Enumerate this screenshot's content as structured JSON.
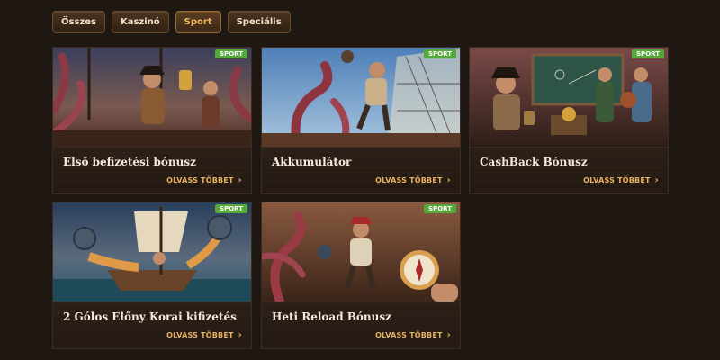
{
  "tabs": [
    {
      "label": "Összes"
    },
    {
      "label": "Kaszinó"
    },
    {
      "label": "Sport"
    },
    {
      "label": "Speciális"
    }
  ],
  "active_tab": "Sport",
  "read_more_label": "OLVASS TÖBBET",
  "badge_color": "#55a83a",
  "accent_color": "#e7b15f",
  "cards": [
    {
      "badge": "SPORT",
      "title": "Első befizetési bónusz",
      "image": "pirates-with-trophy-and-kraken-illustration"
    },
    {
      "badge": "SPORT",
      "title": "Akkumulátor",
      "image": "pirate-kicking-ball-kraken-ship-illustration"
    },
    {
      "badge": "SPORT",
      "title": "CashBack Bónusz",
      "image": "pirates-tactics-board-treasure-illustration"
    },
    {
      "badge": "SPORT",
      "title": "2 Gólos Előny Korai kifizetés",
      "image": "pirate-ship-firing-cannonballs-illustration"
    },
    {
      "badge": "SPORT",
      "title": "Heti Reload Bónusz",
      "image": "pirate-with-compass-kraken-illustration"
    }
  ]
}
